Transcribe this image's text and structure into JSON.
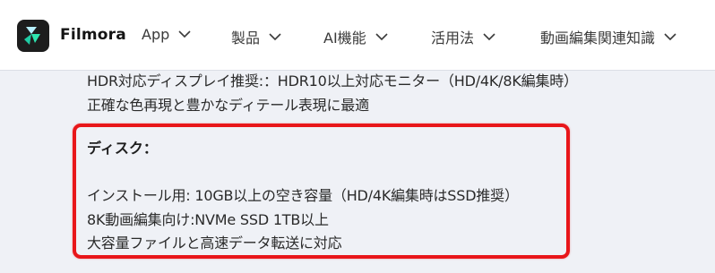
{
  "brand": {
    "name": "Filmora",
    "accent": "#1fcca4"
  },
  "nav": {
    "items": [
      {
        "label": "App",
        "icon": "chevron-down-icon"
      },
      {
        "label": "製品",
        "icon": "chevron-down-icon"
      },
      {
        "label": "AI機能",
        "icon": "chevron-down-icon"
      },
      {
        "label": "活用法",
        "icon": "chevron-down-icon"
      },
      {
        "label": "動画編集関連知識",
        "icon": "chevron-down-icon"
      }
    ]
  },
  "display_section": {
    "line1": "HDR対応ディスプレイ推奨:：HDR10以上対応モニター（HD/4K/8K編集時）",
    "line2": "正確な色再現と豊かなディテール表現に最適"
  },
  "disk_section": {
    "heading": "ディスク：",
    "line1": "インストール用: 10GB以上の空き容量（HD/4K編集時はSSD推奨）",
    "line2": "8K動画編集向け:NVMe SSD 1TB以上",
    "line3": "大容量ファイルと高速データ転送に対応",
    "highlight_color": "#e8161a"
  }
}
